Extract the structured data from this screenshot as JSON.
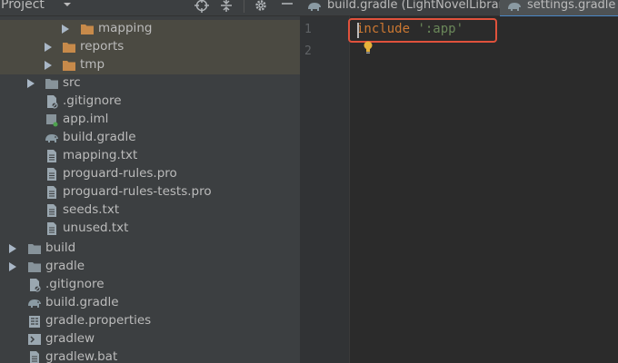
{
  "project_panel": {
    "title": "Project",
    "tree": [
      {
        "label": "mapping",
        "type": "folder-orange",
        "expandable": true
      },
      {
        "label": "reports",
        "type": "folder-orange",
        "expandable": true
      },
      {
        "label": "tmp",
        "type": "folder-orange",
        "expandable": true
      },
      {
        "label": "src",
        "type": "folder",
        "expandable": true
      },
      {
        "label": ".gitignore",
        "type": "gitignore"
      },
      {
        "label": "app.iml",
        "type": "iml"
      },
      {
        "label": "build.gradle",
        "type": "gradle"
      },
      {
        "label": "mapping.txt",
        "type": "text"
      },
      {
        "label": "proguard-rules.pro",
        "type": "text"
      },
      {
        "label": "proguard-rules-tests.pro",
        "type": "text"
      },
      {
        "label": "seeds.txt",
        "type": "text"
      },
      {
        "label": "unused.txt",
        "type": "text"
      },
      {
        "label": "build",
        "type": "folder",
        "expandable": true
      },
      {
        "label": "gradle",
        "type": "folder",
        "expandable": true
      },
      {
        "label": ".gitignore",
        "type": "gitignore"
      },
      {
        "label": "build.gradle",
        "type": "gradle"
      },
      {
        "label": "gradle.properties",
        "type": "properties"
      },
      {
        "label": "gradlew",
        "type": "terminal"
      },
      {
        "label": "gradlew.bat",
        "type": "text"
      }
    ]
  },
  "editor": {
    "tabs": [
      {
        "label": "build.gradle (LightNovelLibrary)",
        "active": false
      },
      {
        "label": "settings.gradle",
        "active": true
      }
    ],
    "line_numbers": [
      "1",
      "2"
    ],
    "code": {
      "keyword": "include",
      "space": " ",
      "string": "':app'"
    }
  },
  "colors": {
    "annotation": "#e0523c",
    "folder_orange": "#c78a4a",
    "folder": "#87939a",
    "keyword": "#cc7832",
    "string": "#6a8759"
  }
}
